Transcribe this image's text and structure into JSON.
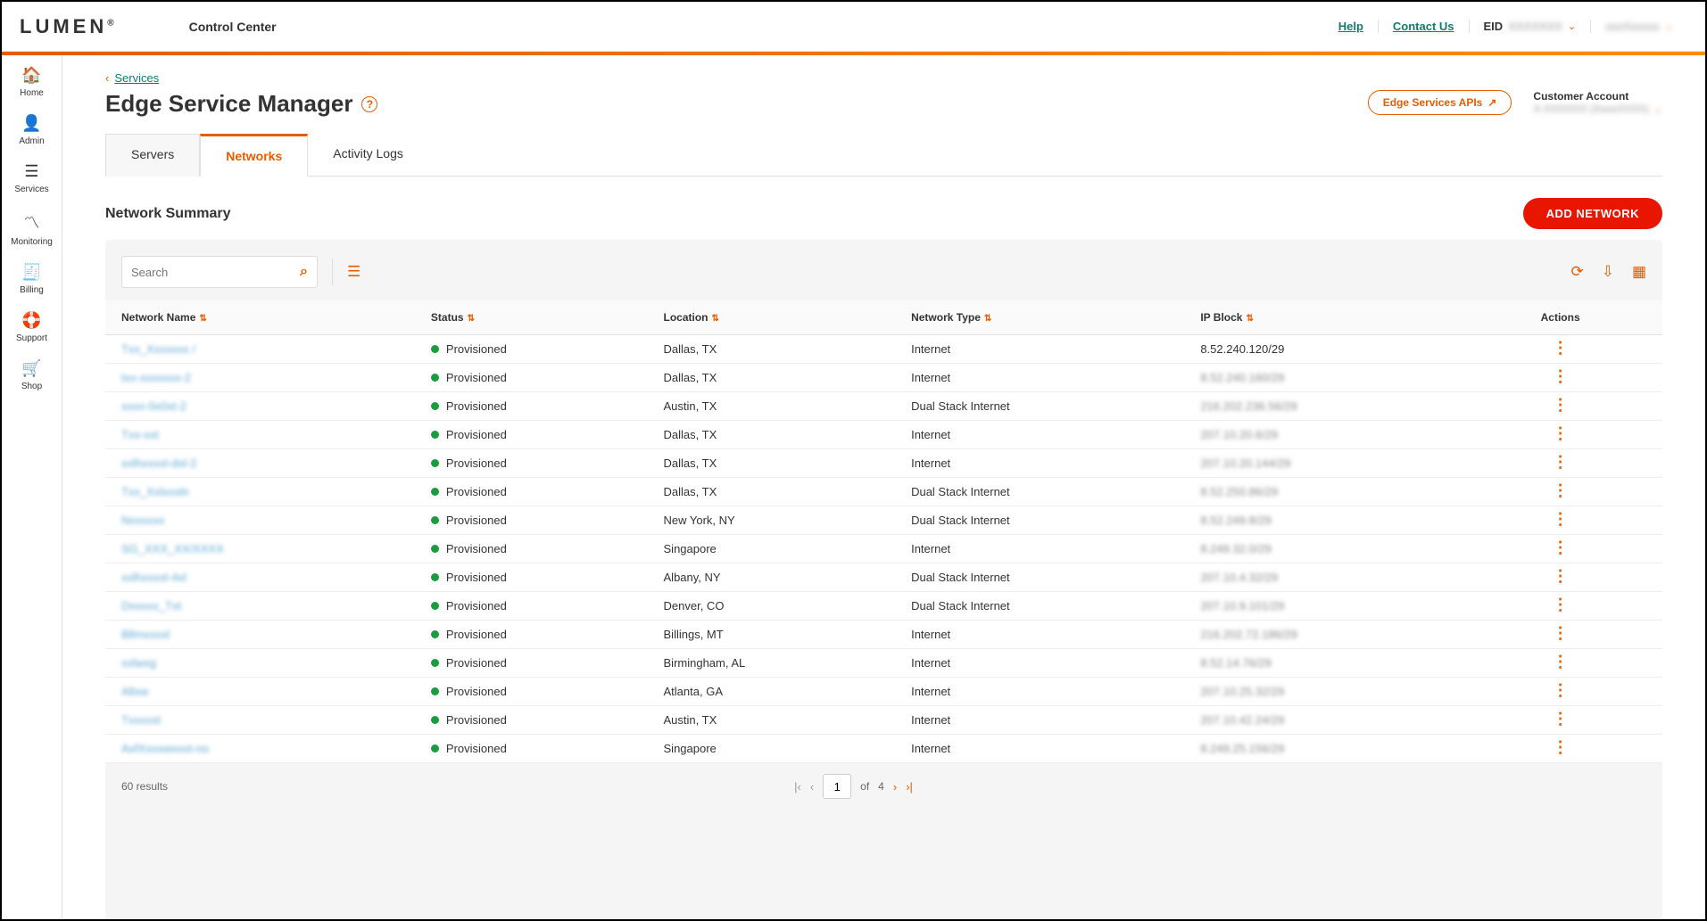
{
  "header": {
    "logo": "LUMEN",
    "app_title": "Control Center",
    "help": "Help",
    "contact": "Contact Us",
    "eid_label": "EID",
    "eid_value": "XXXXXXX",
    "user": "xxxXxxxxx"
  },
  "sidebar": [
    {
      "icon": "🏠",
      "label": "Home"
    },
    {
      "icon": "👤",
      "label": "Admin"
    },
    {
      "icon": "☰",
      "label": "Services"
    },
    {
      "icon": "〽",
      "label": "Monitoring"
    },
    {
      "icon": "🧾",
      "label": "Billing"
    },
    {
      "icon": "🛟",
      "label": "Support"
    },
    {
      "icon": "🛒",
      "label": "Shop"
    }
  ],
  "breadcrumb": {
    "back": "Services"
  },
  "page": {
    "title": "Edge Service Manager",
    "api_button": "Edge Services APIs",
    "customer_label": "Customer Account",
    "customer_value": "X-XXXXXX (XxxxXXXX)"
  },
  "tabs": [
    "Servers",
    "Networks",
    "Activity Logs"
  ],
  "active_tab": "Networks",
  "section": {
    "title": "Network Summary",
    "add_button": "ADD NETWORK"
  },
  "search": {
    "placeholder": "Search"
  },
  "columns": [
    "Network Name",
    "Status",
    "Location",
    "Network Type",
    "IP Block",
    "Actions"
  ],
  "status_label": "Provisioned",
  "rows": [
    {
      "name": "Txx_Xxxxxxx /",
      "location": "Dallas, TX",
      "type": "Internet",
      "ip": "8.52.240.120/29",
      "ip_clear": true
    },
    {
      "name": "txx-xxxxxxx-2",
      "location": "Dallas, TX",
      "type": "Internet",
      "ip": "8.52.240.160/29"
    },
    {
      "name": "xxxx-0x0xt-2",
      "location": "Austin, TX",
      "type": "Dual Stack Internet",
      "ip": "216.202.236.56/29"
    },
    {
      "name": "Txx-xxt",
      "location": "Dallas, TX",
      "type": "Internet",
      "ip": "207.10.20.6/29"
    },
    {
      "name": "xxlhxxxxl-dxl-2",
      "location": "Dallas, TX",
      "type": "Internet",
      "ip": "207.10.20.144/29"
    },
    {
      "name": "Txx_Xxlxxxln",
      "location": "Dallas, TX",
      "type": "Dual Stack Internet",
      "ip": "8.52.250.86/29"
    },
    {
      "name": "Nxxxxxx",
      "location": "New York, NY",
      "type": "Dual Stack Internet",
      "ip": "8.52.249.8/29"
    },
    {
      "name": "SG_XXX_XX/XXXX",
      "location": "Singapore",
      "type": "Internet",
      "ip": "8.249.32.0/29"
    },
    {
      "name": "xxlhxxxxl-4xl",
      "location": "Albany, NY",
      "type": "Dual Stack Internet",
      "ip": "207.10.4.32/29"
    },
    {
      "name": "Dxxxxx_Txt",
      "location": "Denver, CO",
      "type": "Dual Stack Internet",
      "ip": "207.10.9.101/29"
    },
    {
      "name": "Bllmxxxxl",
      "location": "Billings, MT",
      "type": "Internet",
      "ip": "216.202.72.186/29"
    },
    {
      "name": "xxlwxg",
      "location": "Birmingham, AL",
      "type": "Internet",
      "ip": "8.52.14.76/29"
    },
    {
      "name": "Allxw",
      "location": "Atlanta, GA",
      "type": "Internet",
      "ip": "207.10.25.32/29"
    },
    {
      "name": "Txxxxxt",
      "location": "Austin, TX",
      "type": "Internet",
      "ip": "207.10.42.24/29"
    },
    {
      "name": "AxfXxxxwxxxt-no",
      "location": "Singapore",
      "type": "Internet",
      "ip": "8.249.25.156/29"
    }
  ],
  "pagination": {
    "results_text": "60 results",
    "page": "1",
    "of_label": "of",
    "total_pages": "4"
  }
}
